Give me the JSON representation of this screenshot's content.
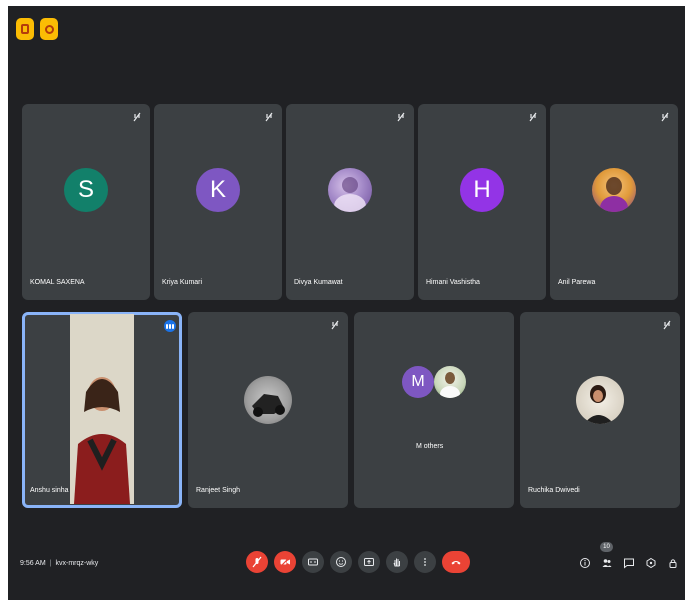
{
  "participants_row1": [
    {
      "name": "KOMAL SAXENA",
      "initial": "S",
      "color": "#12806a",
      "type": "letter"
    },
    {
      "name": "Kriya Kumari",
      "initial": "K",
      "color": "#7e57c2",
      "type": "letter"
    },
    {
      "name": "Divya Kumawat",
      "initial": "",
      "color": "#8e7cc3",
      "type": "photo"
    },
    {
      "name": "Himani Vashistha",
      "initial": "H",
      "color": "#9334e6",
      "type": "letter"
    },
    {
      "name": "Anil Parewa",
      "initial": "",
      "color": "#d97706",
      "type": "photo"
    }
  ],
  "participants_row2": [
    {
      "name": "Anshu sinha",
      "type": "video"
    },
    {
      "name": "Ranjeet Singh",
      "type": "photo"
    },
    {
      "name": "M others",
      "initial": "M",
      "type": "group"
    },
    {
      "name": "Ruchika Dwivedi",
      "type": "photo"
    }
  ],
  "footer": {
    "time": "9:56 AM",
    "meeting_code": "kvx-mrqz-wky",
    "participant_count": "10"
  },
  "colors": {
    "background": "#202124",
    "tile": "#3c4043",
    "active_outline": "#8ab4f8",
    "danger": "#ea4335",
    "topbar_button": "#fbbc04"
  },
  "icons": {
    "topbar": [
      "picture-in-picture-icon",
      "activity-icon"
    ],
    "controls": [
      "mic-off-icon",
      "camera-off-icon",
      "captions-icon",
      "emoji-icon",
      "present-icon",
      "raise-hand-icon",
      "more-options-icon",
      "leave-call-icon"
    ],
    "right_tools": [
      "info-icon",
      "people-icon",
      "chat-icon",
      "activities-icon",
      "host-controls-icon"
    ]
  }
}
